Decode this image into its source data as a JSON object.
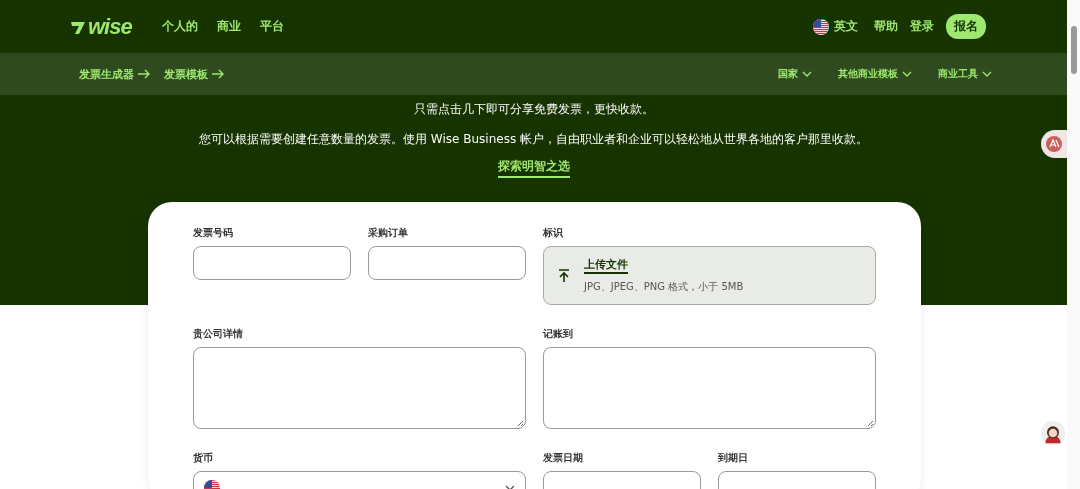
{
  "header": {
    "logo": "wise",
    "nav": [
      "个人的",
      "商业",
      "平台"
    ],
    "language": "英文",
    "links": [
      "帮助",
      "登录"
    ],
    "signup": "报名"
  },
  "subnav": {
    "links": [
      "发票生成器",
      "发票模板"
    ],
    "menus": [
      "国家",
      "其他商业模板",
      "商业工具"
    ]
  },
  "hero": {
    "tagline": "只需点击几下即可分享免费发票，更快收款。",
    "description": "您可以根据需要创建任意数量的发票。使用 Wise Business 帐户，自由职业者和企业可以轻松地从世界各地的客户那里收款。",
    "link": "探索明智之选"
  },
  "form": {
    "rows": [
      {
        "fields": [
          {
            "kind": "text",
            "label": "发票号码"
          },
          {
            "kind": "text",
            "label": "采购订单"
          },
          {
            "kind": "upload",
            "label": "标识",
            "action": "上传文件",
            "hint": "JPG、JPEG、PNG 格式，小于 5MB"
          }
        ]
      },
      {
        "fields": [
          {
            "kind": "textarea",
            "label": "贵公司详情"
          },
          {
            "kind": "textarea",
            "label": "记账到"
          }
        ]
      },
      {
        "fields": [
          {
            "kind": "select",
            "label": "货币"
          },
          {
            "kind": "date",
            "label": "发票日期"
          },
          {
            "kind": "date",
            "label": "到期日"
          }
        ]
      }
    ]
  }
}
